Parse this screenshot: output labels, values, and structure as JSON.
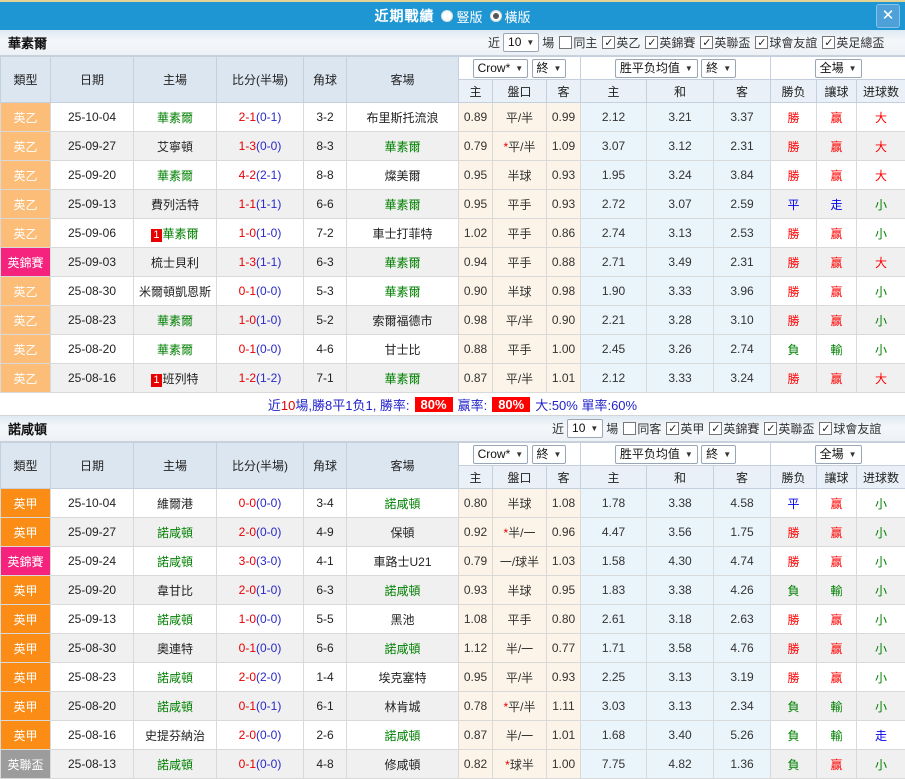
{
  "titlebar": {
    "title": "近期戰績",
    "radios": [
      {
        "label": "豎版",
        "checked": false
      },
      {
        "label": "橫版",
        "checked": true
      }
    ],
    "close_label": "✕"
  },
  "table_header": {
    "type": "類型",
    "date": "日期",
    "home": "主場",
    "score": "比分(半場)",
    "corner": "角球",
    "away": "客場",
    "dd_crow": "Crow*",
    "dd_final1": "終",
    "dd_avg": "胜平负均值",
    "dd_final2": "終",
    "dd_full": "全場",
    "odds_home": "主",
    "odds_handicap": "盤口",
    "odds_away": "客",
    "avg_home": "主",
    "avg_draw": "和",
    "avg_away": "客",
    "res_wdl": "勝负",
    "res_handicap": "讓球",
    "res_goals": "进球数"
  },
  "league_colors": {
    "英乙": "#FBBD77",
    "英甲": "#FB8C15",
    "英錦賽": "#F5237D",
    "英聯盃": "#9C9C9C"
  },
  "result_colors": {
    "勝": "#FF0000",
    "赢": "#FF0000",
    "大": "#FF0000",
    "平": "#0000EE",
    "走": "#0000EE",
    "負": "#008000",
    "輸": "#008000",
    "小": "#008000"
  },
  "sections": [
    {
      "team": "華素爾",
      "filter": {
        "near": "近",
        "games": "10",
        "unit": "場",
        "same": {
          "label": "同主",
          "checked": false
        },
        "leagues": [
          {
            "label": "英乙",
            "checked": true
          },
          {
            "label": "英錦賽",
            "checked": true
          },
          {
            "label": "英聯盃",
            "checked": true
          },
          {
            "label": "球會友誼",
            "checked": true
          },
          {
            "label": "英足總盃",
            "checked": true
          }
        ]
      },
      "rows": [
        {
          "type": "英乙",
          "date": "25-10-04",
          "home": "華素爾",
          "home_green": true,
          "score": "2-1",
          "half": "(0-1)",
          "corner": "3-2",
          "away": "布里斯托流浪",
          "odds": [
            "0.89",
            "平/半",
            "0.99"
          ],
          "avg": [
            "2.12",
            "3.21",
            "3.37"
          ],
          "res": [
            "勝",
            "赢",
            "大"
          ]
        },
        {
          "type": "英乙",
          "date": "25-09-27",
          "home": "艾寧頓",
          "score": "1-3",
          "half": "(0-0)",
          "corner": "8-3",
          "away": "華素爾",
          "away_green": true,
          "odds": [
            "0.79",
            "*平/半",
            "1.09"
          ],
          "avg": [
            "3.07",
            "3.12",
            "2.31"
          ],
          "res": [
            "勝",
            "赢",
            "大"
          ]
        },
        {
          "type": "英乙",
          "date": "25-09-20",
          "home": "華素爾",
          "home_green": true,
          "score": "4-2",
          "half": "(2-1)",
          "corner": "8-8",
          "away": "燦美爾",
          "odds": [
            "0.95",
            "半球",
            "0.93"
          ],
          "avg": [
            "1.95",
            "3.24",
            "3.84"
          ],
          "res": [
            "勝",
            "赢",
            "大"
          ]
        },
        {
          "type": "英乙",
          "date": "25-09-13",
          "home": "費列活特",
          "score": "1-1",
          "half": "(1-1)",
          "corner": "6-6",
          "away": "華素爾",
          "away_green": true,
          "odds": [
            "0.95",
            "平手",
            "0.93"
          ],
          "avg": [
            "2.72",
            "3.07",
            "2.59"
          ],
          "res": [
            "平",
            "走",
            "小"
          ]
        },
        {
          "type": "英乙",
          "date": "25-09-06",
          "home": "華素爾",
          "home_green": true,
          "home_badge": "1",
          "score": "1-0",
          "half": "(1-0)",
          "corner": "7-2",
          "away": "車士打菲特",
          "odds": [
            "1.02",
            "平手",
            "0.86"
          ],
          "avg": [
            "2.74",
            "3.13",
            "2.53"
          ],
          "res": [
            "勝",
            "赢",
            "小"
          ]
        },
        {
          "type": "英錦賽",
          "date": "25-09-03",
          "home": "梳士貝利",
          "score": "1-3",
          "half": "(1-1)",
          "corner": "6-3",
          "away": "華素爾",
          "away_green": true,
          "odds": [
            "0.94",
            "平手",
            "0.88"
          ],
          "avg": [
            "2.71",
            "3.49",
            "2.31"
          ],
          "res": [
            "勝",
            "赢",
            "大"
          ]
        },
        {
          "type": "英乙",
          "date": "25-08-30",
          "home": "米爾頓凱恩斯",
          "score": "0-1",
          "half": "(0-0)",
          "corner": "5-3",
          "away": "華素爾",
          "away_green": true,
          "odds": [
            "0.90",
            "半球",
            "0.98"
          ],
          "avg": [
            "1.90",
            "3.33",
            "3.96"
          ],
          "res": [
            "勝",
            "赢",
            "小"
          ]
        },
        {
          "type": "英乙",
          "date": "25-08-23",
          "home": "華素爾",
          "home_green": true,
          "score": "1-0",
          "half": "(1-0)",
          "corner": "5-2",
          "away": "索爾福德市",
          "odds": [
            "0.98",
            "平/半",
            "0.90"
          ],
          "avg": [
            "2.21",
            "3.28",
            "3.10"
          ],
          "res": [
            "勝",
            "赢",
            "小"
          ]
        },
        {
          "type": "英乙",
          "date": "25-08-20",
          "home": "華素爾",
          "home_green": true,
          "score": "0-1",
          "half": "(0-0)",
          "corner": "4-6",
          "away": "甘士比",
          "odds": [
            "0.88",
            "平手",
            "1.00"
          ],
          "avg": [
            "2.45",
            "3.26",
            "2.74"
          ],
          "res": [
            "負",
            "輸",
            "小"
          ]
        },
        {
          "type": "英乙",
          "date": "25-08-16",
          "home": "班列特",
          "home_badge": "1",
          "score": "1-2",
          "half": "(1-2)",
          "corner": "7-1",
          "away": "華素爾",
          "away_green": true,
          "odds": [
            "0.87",
            "平/半",
            "1.01"
          ],
          "avg": [
            "2.12",
            "3.33",
            "3.24"
          ],
          "res": [
            "勝",
            "赢",
            "大"
          ]
        }
      ],
      "summary": {
        "pre": "近",
        "count": "10",
        "mid": "場,勝8平1负1, 勝率:",
        "rate1": "80%",
        "mid2": "赢率:",
        "rate2": "80%",
        "tail": "大:50% 單率:60%"
      }
    },
    {
      "team": "諾咸頓",
      "filter": {
        "near": "近",
        "games": "10",
        "unit": "場",
        "same": {
          "label": "同客",
          "checked": false
        },
        "leagues": [
          {
            "label": "英甲",
            "checked": true
          },
          {
            "label": "英錦賽",
            "checked": true
          },
          {
            "label": "英聯盃",
            "checked": true
          },
          {
            "label": "球會友誼",
            "checked": true
          }
        ]
      },
      "rows": [
        {
          "type": "英甲",
          "date": "25-10-04",
          "home": "維爾港",
          "score": "0-0",
          "half": "(0-0)",
          "corner": "3-4",
          "away": "諾咸頓",
          "away_green": true,
          "odds": [
            "0.80",
            "半球",
            "1.08"
          ],
          "avg": [
            "1.78",
            "3.38",
            "4.58"
          ],
          "res": [
            "平",
            "赢",
            "小"
          ]
        },
        {
          "type": "英甲",
          "date": "25-09-27",
          "home": "諾咸頓",
          "home_green": true,
          "score": "2-0",
          "half": "(0-0)",
          "corner": "4-9",
          "away": "保頓",
          "odds": [
            "0.92",
            "*半/一",
            "0.96"
          ],
          "avg": [
            "4.47",
            "3.56",
            "1.75"
          ],
          "res": [
            "勝",
            "赢",
            "小"
          ]
        },
        {
          "type": "英錦賽",
          "date": "25-09-24",
          "home": "諾咸頓",
          "home_green": true,
          "score": "3-0",
          "half": "(3-0)",
          "corner": "4-1",
          "away": "車路士U21",
          "odds": [
            "0.79",
            "一/球半",
            "1.03"
          ],
          "avg": [
            "1.58",
            "4.30",
            "4.74"
          ],
          "res": [
            "勝",
            "赢",
            "小"
          ]
        },
        {
          "type": "英甲",
          "date": "25-09-20",
          "home": "韋甘比",
          "score": "2-0",
          "half": "(1-0)",
          "corner": "6-3",
          "away": "諾咸頓",
          "away_green": true,
          "odds": [
            "0.93",
            "半球",
            "0.95"
          ],
          "avg": [
            "1.83",
            "3.38",
            "4.26"
          ],
          "res": [
            "負",
            "輸",
            "小"
          ]
        },
        {
          "type": "英甲",
          "date": "25-09-13",
          "home": "諾咸頓",
          "home_green": true,
          "score": "1-0",
          "half": "(0-0)",
          "corner": "5-5",
          "away": "黑池",
          "odds": [
            "1.08",
            "平手",
            "0.80"
          ],
          "avg": [
            "2.61",
            "3.18",
            "2.63"
          ],
          "res": [
            "勝",
            "赢",
            "小"
          ]
        },
        {
          "type": "英甲",
          "date": "25-08-30",
          "home": "奧連特",
          "score": "0-1",
          "half": "(0-0)",
          "corner": "6-6",
          "away": "諾咸頓",
          "away_green": true,
          "odds": [
            "1.12",
            "半/一",
            "0.77"
          ],
          "avg": [
            "1.71",
            "3.58",
            "4.76"
          ],
          "res": [
            "勝",
            "赢",
            "小"
          ]
        },
        {
          "type": "英甲",
          "date": "25-08-23",
          "home": "諾咸頓",
          "home_green": true,
          "score": "2-0",
          "half": "(2-0)",
          "corner": "1-4",
          "away": "埃克塞特",
          "odds": [
            "0.95",
            "平/半",
            "0.93"
          ],
          "avg": [
            "2.25",
            "3.13",
            "3.19"
          ],
          "res": [
            "勝",
            "赢",
            "小"
          ]
        },
        {
          "type": "英甲",
          "date": "25-08-20",
          "home": "諾咸頓",
          "home_green": true,
          "score": "0-1",
          "half": "(0-1)",
          "corner": "6-1",
          "away": "林肯城",
          "odds": [
            "0.78",
            "*平/半",
            "1.11"
          ],
          "avg": [
            "3.03",
            "3.13",
            "2.34"
          ],
          "res": [
            "負",
            "輸",
            "小"
          ]
        },
        {
          "type": "英甲",
          "date": "25-08-16",
          "home": "史提芬納治",
          "score": "2-0",
          "half": "(0-0)",
          "corner": "2-6",
          "away": "諾咸頓",
          "away_green": true,
          "odds": [
            "0.87",
            "半/一",
            "1.01"
          ],
          "avg": [
            "1.68",
            "3.40",
            "5.26"
          ],
          "res": [
            "負",
            "輸",
            "走"
          ]
        },
        {
          "type": "英聯盃",
          "date": "25-08-13",
          "home": "諾咸頓",
          "home_green": true,
          "score": "0-1",
          "half": "(0-0)",
          "corner": "4-8",
          "away": "修咸頓",
          "odds": [
            "0.82",
            "*球半",
            "1.00"
          ],
          "avg": [
            "7.75",
            "4.82",
            "1.36"
          ],
          "res": [
            "負",
            "赢",
            "小"
          ]
        }
      ]
    }
  ]
}
